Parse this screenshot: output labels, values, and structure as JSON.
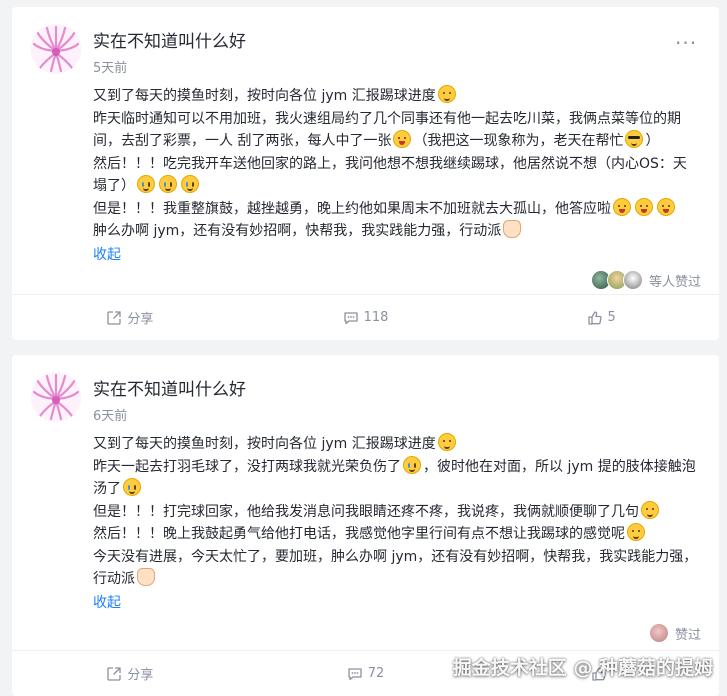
{
  "posts": [
    {
      "author": "实在不知道叫什么好",
      "time": "5天前",
      "more_icon": "more-dots-icon",
      "lines": [
        {
          "parts": [
            {
              "t": "又到了每天的摸鱼时刻，按时向各位 jym 汇报踢球进度"
            },
            {
              "e": "smile"
            }
          ]
        },
        {
          "parts": [
            {
              "t": "昨天临时通知可以不用加班，我火速组局约了几个同事还有他一起去吃川菜，我俩点菜等位的期间，去刮了彩票，一人 刮了两张，每人中了一张"
            },
            {
              "e": "laugh"
            },
            {
              "t": "（我把这一现象称为，老天在帮忙"
            },
            {
              "e": "cool"
            },
            {
              "t": "）"
            }
          ]
        },
        {
          "parts": [
            {
              "t": "然后！！！吃完我开车送他回家的路上，我问他想不想我继续踢球，他居然说不想（内心OS：天塌了）"
            },
            {
              "e": "cry"
            },
            {
              "e": "cry"
            },
            {
              "e": "cry"
            }
          ]
        },
        {
          "parts": [
            {
              "t": "但是！！！我重整旗鼓，越挫越勇，晚上约他如果周末不加班就去大孤山，他答应啦"
            },
            {
              "e": "laugh"
            },
            {
              "e": "laugh"
            },
            {
              "e": "laugh"
            }
          ]
        },
        {
          "parts": [
            {
              "t": "肿么办啊 jym，还有没有妙招啊，快帮我，我实践能力强，行动派"
            },
            {
              "e": "hand"
            }
          ]
        }
      ],
      "collapse": "收起",
      "likers_text": "等人赞过",
      "actions": {
        "share": "分享",
        "comments": "118",
        "likes": "5"
      }
    },
    {
      "author": "实在不知道叫什么好",
      "time": "6天前",
      "more_icon": "more-dots-icon",
      "lines": [
        {
          "parts": [
            {
              "t": "又到了每天的摸鱼时刻，按时向各位 jym 汇报踢球进度"
            },
            {
              "e": "smile"
            }
          ]
        },
        {
          "parts": [
            {
              "t": "昨天一起去打羽毛球了，没打两球我就光荣负伤了"
            },
            {
              "e": "cry"
            },
            {
              "t": "，彼时他在对面，所以 jym 提的肢体接触泡汤了"
            },
            {
              "e": "cry"
            }
          ]
        },
        {
          "parts": [
            {
              "t": "但是！！！打完球回家，他给我发消息问我眼睛还疼不疼，我说疼，我俩就顺便聊了几句"
            },
            {
              "e": "smile"
            }
          ]
        },
        {
          "parts": [
            {
              "t": "然后！！！晚上我鼓起勇气给他打电话，我感觉他字里行间有点不想让我踢球的感觉呢"
            },
            {
              "e": "smile"
            }
          ]
        },
        {
          "parts": [
            {
              "t": "今天没有进展，今天太忙了，要加班，肿么办啊 jym，还有没有妙招啊，快帮我，我实践能力强，行动派"
            },
            {
              "e": "hand"
            }
          ]
        }
      ],
      "collapse": "收起",
      "likers_text": "赞过",
      "actions": {
        "share": "分享",
        "comments": "72",
        "likes": ""
      }
    }
  ],
  "watermark": "掘金技术社区 @ 种蘑菇的提姆",
  "colors": {
    "link": "#1e80ff",
    "muted": "#8a919f",
    "text": "#252933",
    "background": "#f2f3f5"
  }
}
